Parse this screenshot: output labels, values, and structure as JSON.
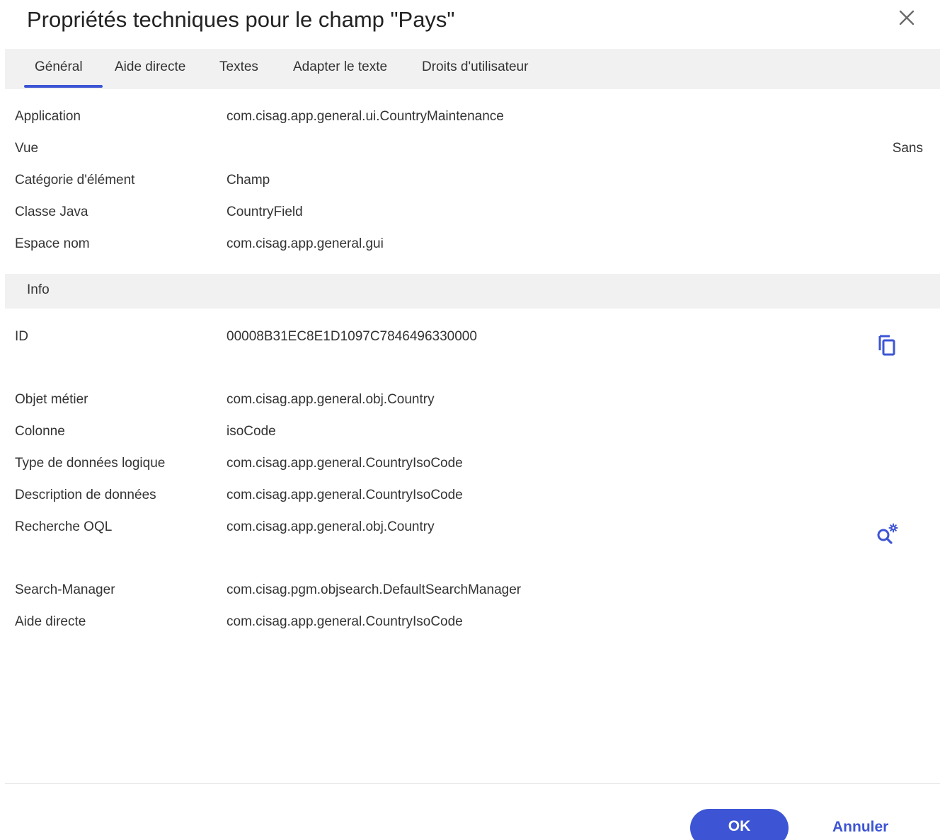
{
  "dialog": {
    "title": "Propriétés techniques pour le champ \"Pays\"",
    "close_icon": "close-icon",
    "accent_color": "#3d55d4"
  },
  "tabs": [
    {
      "label": "Général",
      "active": true
    },
    {
      "label": "Aide directe",
      "active": false
    },
    {
      "label": "Textes",
      "active": false
    },
    {
      "label": "Adapter le texte",
      "active": false
    },
    {
      "label": "Droits d'utilisateur",
      "active": false
    }
  ],
  "general": [
    {
      "label": "Application",
      "value": "com.cisag.app.general.ui.CountryMaintenance"
    },
    {
      "label": "Vue",
      "value": "",
      "right_value": "Sans"
    },
    {
      "label": "Catégorie d'élément",
      "value": "Champ"
    },
    {
      "label": "Classe Java",
      "value": "CountryField"
    },
    {
      "label": "Espace nom",
      "value": "com.cisag.app.general.gui"
    }
  ],
  "info": {
    "header": "Info",
    "rows": [
      {
        "label": "ID",
        "value": "00008B31EC8E1D1097C7846496330000",
        "action_icon": "copy-icon"
      },
      {
        "label": "Objet métier",
        "value": "com.cisag.app.general.obj.Country"
      },
      {
        "label": "Colonne",
        "value": "isoCode"
      },
      {
        "label": "Type de données logique",
        "value": "com.cisag.app.general.CountryIsoCode"
      },
      {
        "label": "Description de données",
        "value": "com.cisag.app.general.CountryIsoCode"
      },
      {
        "label": "Recherche OQL",
        "value": "com.cisag.app.general.obj.Country",
        "action_icon": "search-settings-icon"
      },
      {
        "label": "Search-Manager",
        "value": "com.cisag.pgm.objsearch.DefaultSearchManager"
      },
      {
        "label": "Aide directe",
        "value": "com.cisag.app.general.CountryIsoCode"
      }
    ]
  },
  "footer": {
    "ok_label": "OK",
    "cancel_label": "Annuler"
  }
}
